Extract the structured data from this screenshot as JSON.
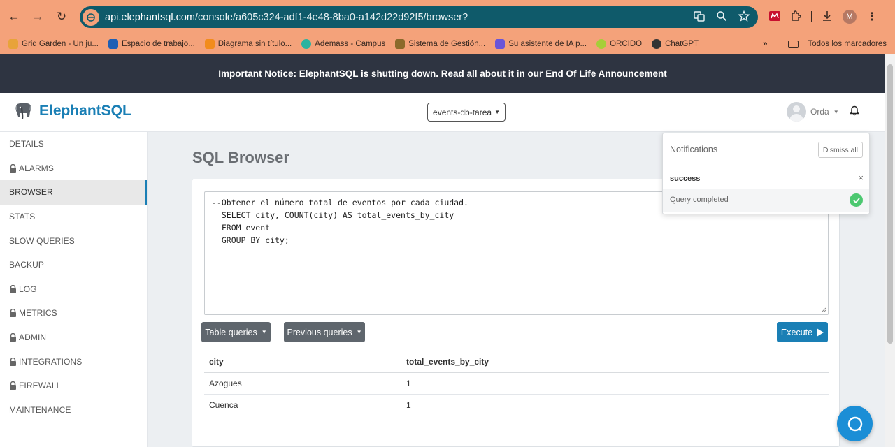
{
  "browser": {
    "url_host": "api.elephantsql.com",
    "url_path": "/console/a605c324-adf1-4e48-8ba0-a142d22d92f5/browser?",
    "profile_initial": "M",
    "bookmarks": [
      {
        "label": "Grid Garden - Un ju...",
        "color": "#e8a33a"
      },
      {
        "label": "Espacio de trabajo...",
        "color": "#1f5fb4"
      },
      {
        "label": "Diagrama sin título...",
        "color": "#f28c1c"
      },
      {
        "label": "Ademass - Campus",
        "color": "#2ab3a0"
      },
      {
        "label": "Sistema de Gestión...",
        "color": "#8b6a2b"
      },
      {
        "label": "Su asistente de IA p...",
        "color": "#6a55d8"
      },
      {
        "label": "ORCIDO",
        "color": "#a6ce39"
      },
      {
        "label": "ChatGPT",
        "color": "#333333"
      }
    ],
    "all_bookmarks_label": "Todos los marcadores"
  },
  "notice": {
    "text": "Important Notice: ElephantSQL is shutting down. Read all about it in our",
    "link": "End Of Life Announcement"
  },
  "header": {
    "brand": "ElephantSQL",
    "instance": "events-db-tarea",
    "user": "Orda"
  },
  "sidebar": {
    "items": [
      {
        "label": "DETAILS",
        "locked": false,
        "active": false
      },
      {
        "label": "ALARMS",
        "locked": true,
        "active": false
      },
      {
        "label": "BROWSER",
        "locked": false,
        "active": true
      },
      {
        "label": "STATS",
        "locked": false,
        "active": false
      },
      {
        "label": "SLOW QUERIES",
        "locked": false,
        "active": false
      },
      {
        "label": "BACKUP",
        "locked": false,
        "active": false
      },
      {
        "label": "LOG",
        "locked": true,
        "active": false
      },
      {
        "label": "METRICS",
        "locked": true,
        "active": false
      },
      {
        "label": "ADMIN",
        "locked": true,
        "active": false
      },
      {
        "label": "INTEGRATIONS",
        "locked": true,
        "active": false
      },
      {
        "label": "FIREWALL",
        "locked": true,
        "active": false
      },
      {
        "label": "MAINTENANCE",
        "locked": false,
        "active": false
      }
    ]
  },
  "main": {
    "title": "SQL Browser",
    "query_lines": [
      "--Obtener el número total de eventos por cada ciudad.",
      "",
      "  SELECT city, COUNT(city) AS total_events_by_city",
      "  FROM event",
      "  GROUP BY city;"
    ],
    "table_queries_label": "Table queries",
    "previous_queries_label": "Previous queries",
    "execute_label": "Execute",
    "results": {
      "columns": [
        "city",
        "total_events_by_city"
      ],
      "rows": [
        [
          "Azogues",
          "1"
        ],
        [
          "Cuenca",
          "1"
        ]
      ]
    }
  },
  "notifications": {
    "title": "Notifications",
    "dismiss_label": "Dismiss all",
    "type": "success",
    "message": "Query completed"
  },
  "colors": {
    "brand": "#1a7fb5",
    "success": "#4cc870",
    "notice_bg": "#2e3441"
  }
}
